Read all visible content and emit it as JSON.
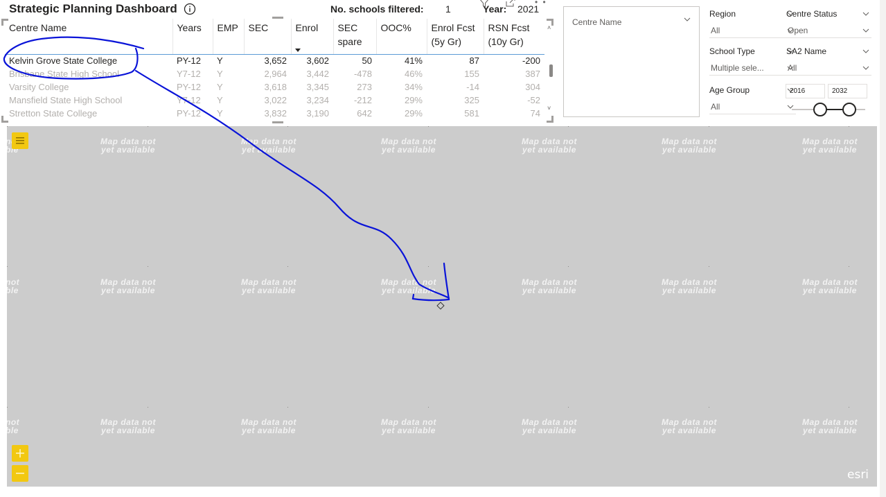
{
  "header": {
    "title": "Strategic Planning Dashboard",
    "filtered_label": "No. schools filtered:",
    "filtered_value": "1",
    "year_label": "Year:",
    "year_value": "2021"
  },
  "table": {
    "columns": [
      "Centre Name",
      "Years",
      "EMP",
      "SEC",
      "Enrol",
      "SEC spare",
      "OOC%",
      "Enrol Fcst (5y Gr)",
      "RSN Fcst (10y Gr)"
    ],
    "rows": [
      {
        "name": "Kelvin Grove State College",
        "years": "PY-12",
        "emp": "Y",
        "sec": "3,652",
        "enrol": "3,602",
        "spare": "50",
        "ooc": "41%",
        "enrol_fcst": "87",
        "rsn_fcst": "-200"
      },
      {
        "name": "Brisbane State High School",
        "years": "Y7-12",
        "emp": "Y",
        "sec": "2,964",
        "enrol": "3,442",
        "spare": "-478",
        "ooc": "46%",
        "enrol_fcst": "155",
        "rsn_fcst": "387"
      },
      {
        "name": "Varsity College",
        "years": "PY-12",
        "emp": "Y",
        "sec": "3,618",
        "enrol": "3,345",
        "spare": "273",
        "ooc": "34%",
        "enrol_fcst": "-14",
        "rsn_fcst": "304"
      },
      {
        "name": "Mansfield State High School",
        "years": "Y7-12",
        "emp": "Y",
        "sec": "3,022",
        "enrol": "3,234",
        "spare": "-212",
        "ooc": "29%",
        "enrol_fcst": "325",
        "rsn_fcst": "-52"
      },
      {
        "name": "Stretton State College",
        "years": "PY-12",
        "emp": "Y",
        "sec": "3,832",
        "enrol": "3,190",
        "spare": "642",
        "ooc": "29%",
        "enrol_fcst": "581",
        "rsn_fcst": "74"
      }
    ]
  },
  "slicers": {
    "centre_name": "Centre Name",
    "region": {
      "title": "Region",
      "value": "All"
    },
    "centre_status": {
      "title": "Centre Status",
      "value": "Open"
    },
    "school_type": {
      "title": "School Type",
      "value": "Multiple sele..."
    },
    "sa2_name": {
      "title": "SA2 Name",
      "value": "All"
    },
    "age_group": {
      "title": "Age Group",
      "value": "All"
    },
    "date_from": "2016",
    "date_to": "2032"
  },
  "map": {
    "placeholder_line1": "Map data not",
    "placeholder_line2": "yet available",
    "placeholder_partial1": "not",
    "placeholder_partial2": "ble",
    "attribution": "esri",
    "zoom_in": "+",
    "zoom_out": "−"
  },
  "colors": {
    "accent_yellow": "#f2c811",
    "map_bg": "#cccccc",
    "annotation_blue": "#0a14d8",
    "header_underline": "#5b9bd5"
  },
  "icons": [
    "info-icon",
    "filter-icon",
    "focus-mode-icon",
    "more-options-icon",
    "chevron-down-icon",
    "map-layers-icon",
    "zoom-in-icon",
    "zoom-out-icon"
  ]
}
